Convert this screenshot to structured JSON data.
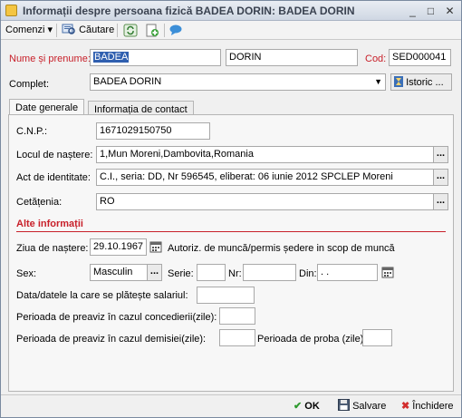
{
  "window": {
    "title": "Informații despre persoana fizică BADEA DORIN: BADEA DORIN",
    "minimize_glyph": "_",
    "maximize_glyph": "□",
    "close_glyph": "✕"
  },
  "toolbar": {
    "menu_label": "Comenzi",
    "menu_arrow": "▾",
    "search_label": "Căutare"
  },
  "header": {
    "name_label": "Nume și prenume:",
    "last_name": "BADEA",
    "first_name": "DORIN",
    "code_label": "Cod:",
    "code_value": "SED000041",
    "full_label": "Complet:",
    "full_value": "BADEA DORIN",
    "history_button": "Istoric ..."
  },
  "tabs": [
    "Date generale",
    "Informația de contact"
  ],
  "general": {
    "cnp_label": "C.N.P.:",
    "cnp_value": "1671029150750",
    "birthplace_label": "Locul de naștere:",
    "birthplace_value": "1,Mun Moreni,Dambovita,Romania",
    "id_label": "Act de identitate:",
    "id_value": "C.I., seria: DD, Nr 596545, eliberat: 06 iunie 2012 SPCLEP Moreni",
    "citizenship_label": "Cetățenia:",
    "citizenship_value": "RO",
    "browse_glyph": "..."
  },
  "other": {
    "section_title": "Alte informații",
    "birthday_label": "Ziua de naștere:",
    "birthday_value": "29.10.1967",
    "work_permit_label": "Autoriz. de muncă/permis ședere in scop de muncă",
    "sex_label": "Sex:",
    "sex_value": "Masculin",
    "series_label": "Serie:",
    "series_value": "",
    "nr_label": "Nr:",
    "nr_value": "",
    "din_label": "Din:",
    "din_value": ". .",
    "salary_dates_label": "Data/datele la care se plătește salariul:",
    "salary_dates_value": "",
    "notice_dismissal_label": "Perioada de preaviz în cazul concedierii(zile):",
    "notice_dismissal_value": "",
    "notice_resignation_label": "Perioada de preaviz în cazul demisiei(zile):",
    "notice_resignation_value": "",
    "probation_label": "Perioada de proba (zile):",
    "probation_value": ""
  },
  "footer": {
    "ok_label": "OK",
    "save_label": "Salvare",
    "close_label": "Închidere"
  },
  "colors": {
    "accent_red": "#c8202a",
    "selection_blue": "#2f5faf",
    "ok_green": "#2e9a2e"
  }
}
